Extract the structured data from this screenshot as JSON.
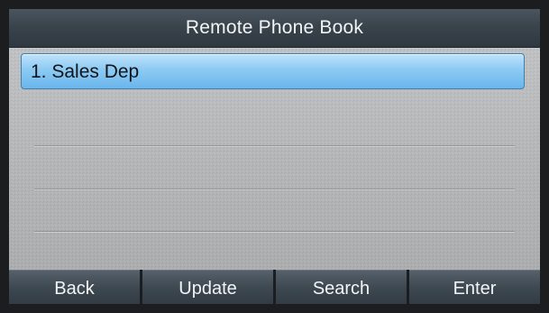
{
  "header": {
    "title": "Remote Phone Book"
  },
  "list": {
    "items": [
      {
        "label": "1. Sales Dep",
        "selected": true
      }
    ]
  },
  "softkeys": [
    {
      "label": "Back"
    },
    {
      "label": "Update"
    },
    {
      "label": "Search"
    },
    {
      "label": "Enter"
    }
  ],
  "colors": {
    "title_bar": "#3a444d",
    "selection": "#8ccaf3",
    "screen_background": "#b7b9bb",
    "softkey": "#3e4851"
  }
}
